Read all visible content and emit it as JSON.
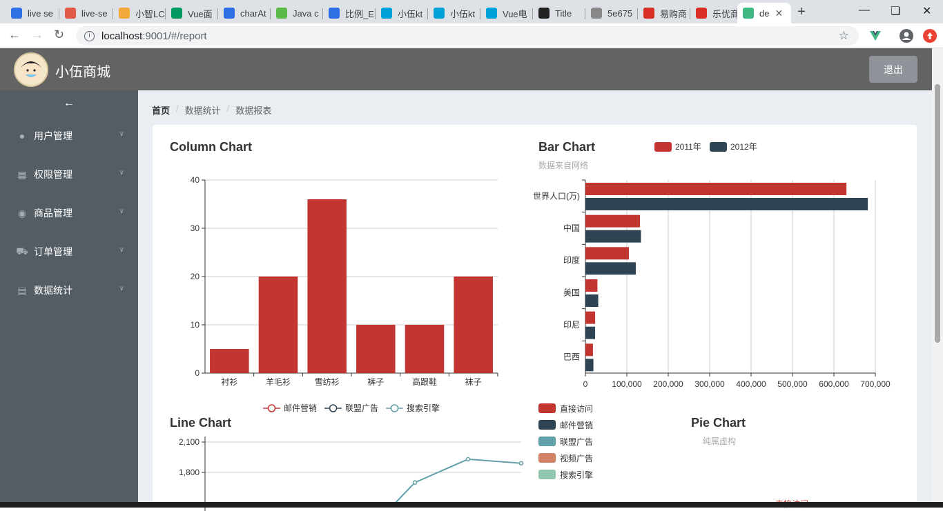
{
  "browser": {
    "tabs": [
      {
        "title": "live se",
        "icon": "paw-icon",
        "color": "#2f6fe4"
      },
      {
        "title": "live-se",
        "icon": "jian-icon",
        "color": "#e05a47"
      },
      {
        "title": "小智LC",
        "icon": "smile-icon",
        "color": "#f2a93b"
      },
      {
        "title": "Vue面",
        "icon": "sf-icon",
        "color": "#009a61"
      },
      {
        "title": "charAt",
        "icon": "paw-icon",
        "color": "#2f6fe4"
      },
      {
        "title": "Java c",
        "icon": "cloud-icon",
        "color": "#58b947"
      },
      {
        "title": "比例_E",
        "icon": "paw-icon",
        "color": "#2f6fe4"
      },
      {
        "title": "小伍kt",
        "icon": "bili-icon",
        "color": "#00a1d6"
      },
      {
        "title": "小伍kt",
        "icon": "bili-icon",
        "color": "#00a1d6"
      },
      {
        "title": "Vue电",
        "icon": "bili-icon",
        "color": "#00a1d6"
      },
      {
        "title": "Title",
        "icon": "webstorm-icon",
        "color": "#222222"
      },
      {
        "title": "5e675",
        "icon": "file-icon",
        "color": "#888888"
      },
      {
        "title": "易购商",
        "icon": "shield-icon",
        "color": "#d93025"
      },
      {
        "title": "乐优商",
        "icon": "shield-icon",
        "color": "#d93025"
      },
      {
        "title": "de",
        "icon": "vue-icon",
        "color": "#41b883",
        "active": true
      }
    ],
    "url_host": "localhost",
    "url_rest": ":9001/#/report"
  },
  "app": {
    "title": "小伍商城",
    "logout_label": "退出"
  },
  "sidebar": {
    "collapse_icon": "arrow-left-icon",
    "items": [
      {
        "label": "用户管理",
        "icon": "user-icon"
      },
      {
        "label": "权限管理",
        "icon": "grid-icon"
      },
      {
        "label": "商品管理",
        "icon": "location-icon"
      },
      {
        "label": "订单管理",
        "icon": "cart-icon"
      },
      {
        "label": "数据统计",
        "icon": "message-icon"
      }
    ]
  },
  "breadcrumb": [
    "首页",
    "数据统计",
    "数据报表"
  ],
  "colors": {
    "red": "#c23531",
    "navy": "#2f4554",
    "teal": "#61a0a8",
    "orange": "#d48265",
    "green": "#91c7ae"
  },
  "charts": {
    "column": {
      "title": "Column Chart"
    },
    "bar": {
      "title": "Bar Chart",
      "subtitle": "数据来自网络"
    },
    "line": {
      "title": "Line Chart"
    },
    "pie": {
      "title": "Pie Chart",
      "subtitle": "纯属虚构",
      "partial_label": "直接访问"
    }
  },
  "chart_data": [
    {
      "type": "bar",
      "title": "Column Chart",
      "categories": [
        "衬衫",
        "羊毛衫",
        "雪纺衫",
        "裤子",
        "高跟鞋",
        "袜子"
      ],
      "values": [
        5,
        20,
        36,
        10,
        10,
        20
      ],
      "ylim": [
        0,
        40
      ],
      "yticks": [
        0,
        10,
        20,
        30,
        40
      ],
      "grid": true
    },
    {
      "type": "bar",
      "orientation": "horizontal",
      "title": "Bar Chart",
      "subtitle": "数据来自网络",
      "categories": [
        "巴西",
        "印尼",
        "美国",
        "印度",
        "中国",
        "世界人口(万)"
      ],
      "series": [
        {
          "name": "2011年",
          "values": [
            18203,
            23489,
            29034,
            104970,
            131744,
            630230
          ]
        },
        {
          "name": "2012年",
          "values": [
            19325,
            23438,
            31000,
            121594,
            134141,
            681807
          ]
        }
      ],
      "xlim": [
        0,
        700000
      ],
      "xticks": [
        "0",
        "100,000",
        "200,000",
        "300,000",
        "400,000",
        "500,000",
        "600,000",
        "700,000"
      ],
      "legend": "top",
      "grid": true
    },
    {
      "type": "line",
      "title": "Line Chart",
      "legend_entries": [
        "邮件营销",
        "联盟广告",
        "搜索引擎"
      ],
      "yticks_visible": [
        "2,100",
        "1,800"
      ],
      "ylim": [
        1500,
        2100
      ],
      "visible_series_points": {
        "name": "搜索引擎",
        "y": [
          1700,
          1930,
          1890
        ]
      },
      "legend": "top"
    },
    {
      "type": "pie",
      "title": "Pie Chart",
      "subtitle": "纯属虚构",
      "legend_entries": [
        "直接访问",
        "邮件营销",
        "联盟广告",
        "视频广告",
        "搜索引擎"
      ],
      "legend": "top-left"
    }
  ]
}
